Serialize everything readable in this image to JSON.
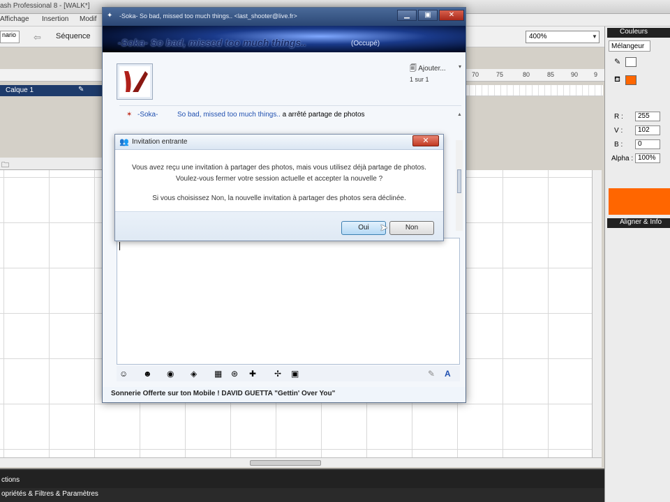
{
  "flash": {
    "title": "ash Professional 8 - [WALK*]",
    "menu": [
      "Affichage",
      "Insertion",
      "Modif"
    ],
    "doc_tab": "nario",
    "scene_label": "Séquence",
    "zoom": "400%",
    "ruler_ticks": [
      "70",
      "75",
      "80",
      "85",
      "90",
      "9"
    ],
    "layer_name": "Calque 1",
    "bottom_panels": {
      "actions": "ctions",
      "properties": "opriétés & Filtres & Paramètres"
    }
  },
  "right_panel": {
    "couleurs": "Couleurs",
    "tab_melangeur": "Mélangeur",
    "r_label": "R :",
    "r_value": "255",
    "v_label": "V :",
    "v_value": "102",
    "b_label": "B :",
    "b_value": "0",
    "alpha_label": "Alpha :",
    "alpha_value": "100%",
    "fill_color": "#ff6600",
    "aligner": "Aligner & Info"
  },
  "messenger": {
    "window_title": "-Soka-      So bad, missed too much things.. <last_shooter@live.fr>",
    "banner_name": "-Soka-    So bad, missed too much things..",
    "banner_status": "(Occupé)",
    "ajouter": "Ajouter...",
    "page_counter": "1 sur 1",
    "notif_contact": "-Soka-",
    "notif_personal": "So bad, missed too much things..",
    "notif_action": " a arrêté partage de photos",
    "footer": "Sonnerie Offerte sur ton Mobile ! DAVID GUETTA \"Gettin' Over You\""
  },
  "dialog": {
    "title": "Invitation entrante",
    "message_line1": "Vous avez reçu une invitation à partager des photos, mais vous utilisez déjà partage de photos.",
    "message_line2": "Voulez-vous fermer votre session actuelle et accepter la nouvelle ?",
    "message_line3": "Si vous choisissez Non, la nouvelle invitation à partager des photos sera déclinée.",
    "yes_label": "Oui",
    "no_label": "Non"
  }
}
